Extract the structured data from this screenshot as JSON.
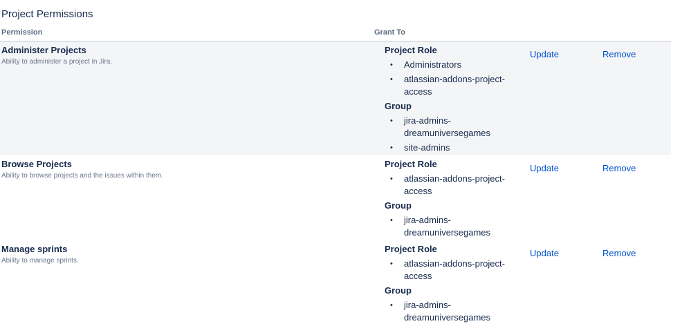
{
  "page": {
    "title": "Project Permissions"
  },
  "table": {
    "headers": {
      "permission": "Permission",
      "grant_to": "Grant To"
    },
    "rows": [
      {
        "name": "Administer Projects",
        "description": "Ability to administer a project in Jira.",
        "grants": [
          {
            "heading": "Project Role",
            "items": [
              "Administrators",
              "atlassian-addons-project-access"
            ]
          },
          {
            "heading": "Group",
            "items": [
              "jira-admins-dreamuniversegames",
              "site-admins"
            ]
          }
        ],
        "update_label": "Update",
        "remove_label": "Remove"
      },
      {
        "name": "Browse Projects",
        "description": "Ability to browse projects and the issues within them.",
        "grants": [
          {
            "heading": "Project Role",
            "items": [
              "atlassian-addons-project-access"
            ]
          },
          {
            "heading": "Group",
            "items": [
              "jira-admins-dreamuniversegames"
            ]
          }
        ],
        "update_label": "Update",
        "remove_label": "Remove"
      },
      {
        "name": "Manage sprints",
        "description": "Ability to manage sprints.",
        "grants": [
          {
            "heading": "Project Role",
            "items": [
              "atlassian-addons-project-access"
            ]
          },
          {
            "heading": "Group",
            "items": [
              "jira-admins-dreamuniversegames"
            ]
          }
        ],
        "update_label": "Update",
        "remove_label": "Remove"
      }
    ]
  },
  "colors": {
    "link": "#0052cc",
    "text": "#172b4d",
    "muted": "#6b778c",
    "row_alt_bg": "#f4f5f7"
  }
}
